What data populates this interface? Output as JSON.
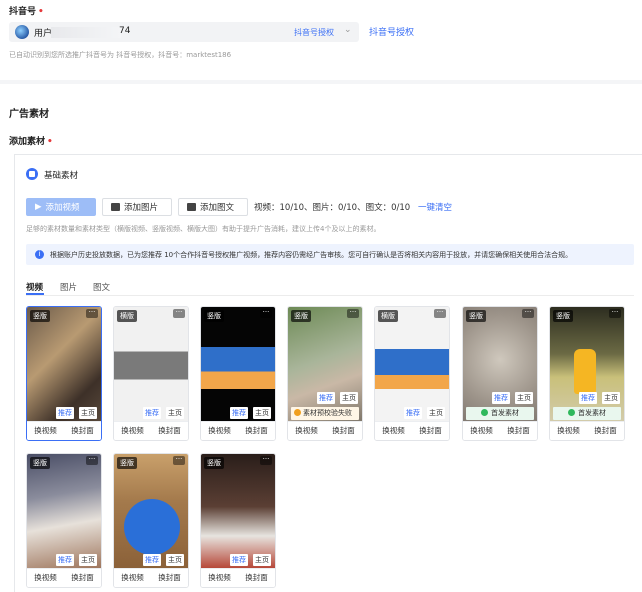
{
  "account": {
    "label": "抖音号",
    "name_prefix": "用户",
    "name_suffix": "74",
    "tag": "抖音号授权",
    "auth_link": "抖音号授权",
    "hint": "已自动识别到您所选推广抖音号为 抖音号授权，抖音号：marktest186"
  },
  "section_title": "广告素材",
  "add_material_label": "添加素材",
  "basic_title": "基础素材",
  "buttons": {
    "add_video": "添加视频",
    "add_image": "添加图片",
    "add_image_text": "添加图文"
  },
  "counts": "视频：10/10、图片：0/10、图文：0/10",
  "clear_all": "一键清空",
  "material_hint": "足够的素材数量和素材类型（横版视频、竖版视频、横版大图）有助于提升广告消耗，建议上传4个及以上的素材。",
  "notice": "根据账户历史投放数据，已为您推荐 10个合作抖音号授权推广视频，推荐内容仍需经广告审核。您可自行确认是否将相关内容用于投放，并请您确保相关使用合法合规。",
  "tabs": [
    "视频",
    "图片",
    "图文"
  ],
  "more_label": "···",
  "card_tags": {
    "recommend": "推荐",
    "home": "主页"
  },
  "card_actions": {
    "replace_video": "换视频",
    "replace_cover": "换封面"
  },
  "cards": [
    {
      "badge": "竖版",
      "status": ""
    },
    {
      "badge": "横版",
      "status": ""
    },
    {
      "badge": "竖版",
      "status": ""
    },
    {
      "badge": "竖版",
      "status": "素材预校验失败"
    },
    {
      "badge": "横版",
      "status": ""
    },
    {
      "badge": "竖版",
      "status": "首发素材"
    },
    {
      "badge": "竖版",
      "status": "首发素材"
    },
    {
      "badge": "竖版",
      "status": ""
    },
    {
      "badge": "竖版",
      "status": ""
    },
    {
      "badge": "竖版",
      "status": ""
    }
  ],
  "colors": {
    "accent": "#3b6ff5",
    "required": "#e5393b",
    "primary_btn_disabled": "#9dbdf7"
  }
}
